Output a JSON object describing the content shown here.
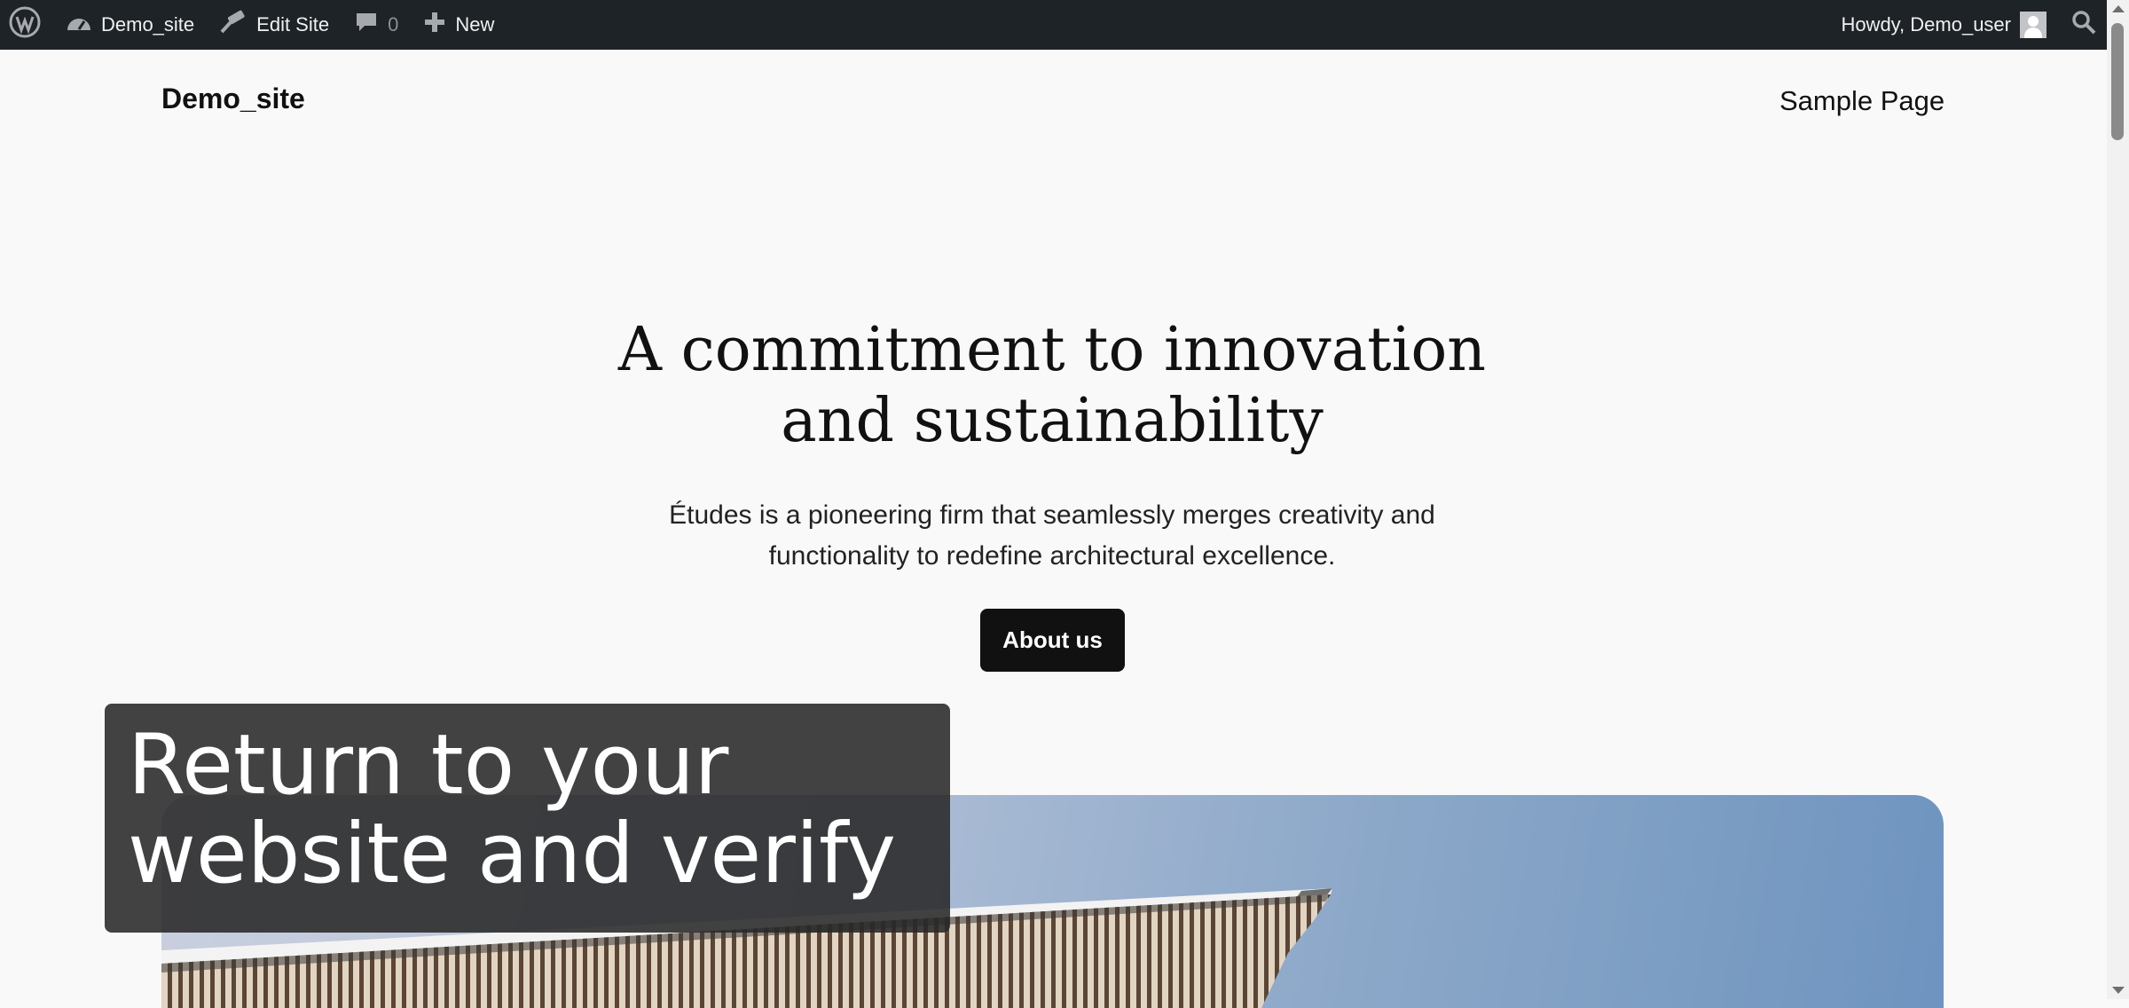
{
  "admin_bar": {
    "site_name": "Demo_site",
    "edit_site": "Edit Site",
    "comments_count": "0",
    "new_label": "New",
    "greeting": "Howdy, Demo_user"
  },
  "header": {
    "site_title": "Demo_site",
    "nav": [
      "Sample Page"
    ]
  },
  "hero": {
    "heading_line1": "A commitment to innovation",
    "heading_line2": "and sustainability",
    "text_line1": "Études is a pioneering firm that seamlessly merges creativity and",
    "text_line2": "functionality to redefine architectural excellence.",
    "button_label": "About us"
  },
  "overlay": {
    "line1": "Return to your",
    "line2": "website and verify"
  },
  "icons": {
    "wordpress": "wordpress-logo-icon",
    "dashboard": "dashboard-icon",
    "edit": "hammer-icon",
    "comment": "comment-icon",
    "new": "plus-icon",
    "search": "search-icon"
  },
  "colors": {
    "admin_bar_bg": "#1d2327",
    "page_bg": "#f9f9f9",
    "button_bg": "#111111"
  }
}
